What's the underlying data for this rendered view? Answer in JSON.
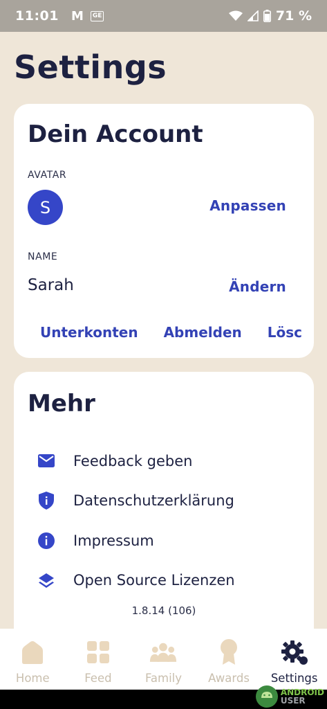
{
  "status_bar": {
    "time": "11:01",
    "battery": "71 %",
    "icons": [
      "gmail-icon",
      "ge-badge-icon",
      "wifi-icon",
      "signal-icon",
      "battery-icon"
    ]
  },
  "page": {
    "title": "Settings"
  },
  "account": {
    "title": "Dein Account",
    "avatar_label": "AVATAR",
    "avatar_initial": "S",
    "avatar_action": "Anpassen",
    "name_label": "NAME",
    "name_value": "Sarah",
    "name_action": "Ändern",
    "actions": [
      "Unterkonten",
      "Abmelden",
      "Lösc"
    ]
  },
  "more": {
    "title": "Mehr",
    "items": [
      {
        "label": "Feedback geben",
        "icon": "mail-icon"
      },
      {
        "label": "Datenschutzerklärung",
        "icon": "shield-icon"
      },
      {
        "label": "Impressum",
        "icon": "info-icon"
      },
      {
        "label": "Open Source Lizenzen",
        "icon": "layers-icon"
      }
    ],
    "version": "1.8.14 (106)"
  },
  "nav": {
    "items": [
      {
        "label": "Home",
        "icon": "home-icon",
        "active": false
      },
      {
        "label": "Feed",
        "icon": "grid-icon",
        "active": false
      },
      {
        "label": "Family",
        "icon": "family-icon",
        "active": false
      },
      {
        "label": "Awards",
        "icon": "award-icon",
        "active": false
      },
      {
        "label": "Settings",
        "icon": "gear-icon",
        "active": true
      }
    ]
  },
  "watermark": {
    "line1": "ANDROID",
    "line2": "USER"
  },
  "colors": {
    "background": "#efe6d8",
    "accent": "#3342b5",
    "avatar": "#3546c8",
    "text": "#1d2141",
    "nav_inactive": "#c9bfae"
  }
}
